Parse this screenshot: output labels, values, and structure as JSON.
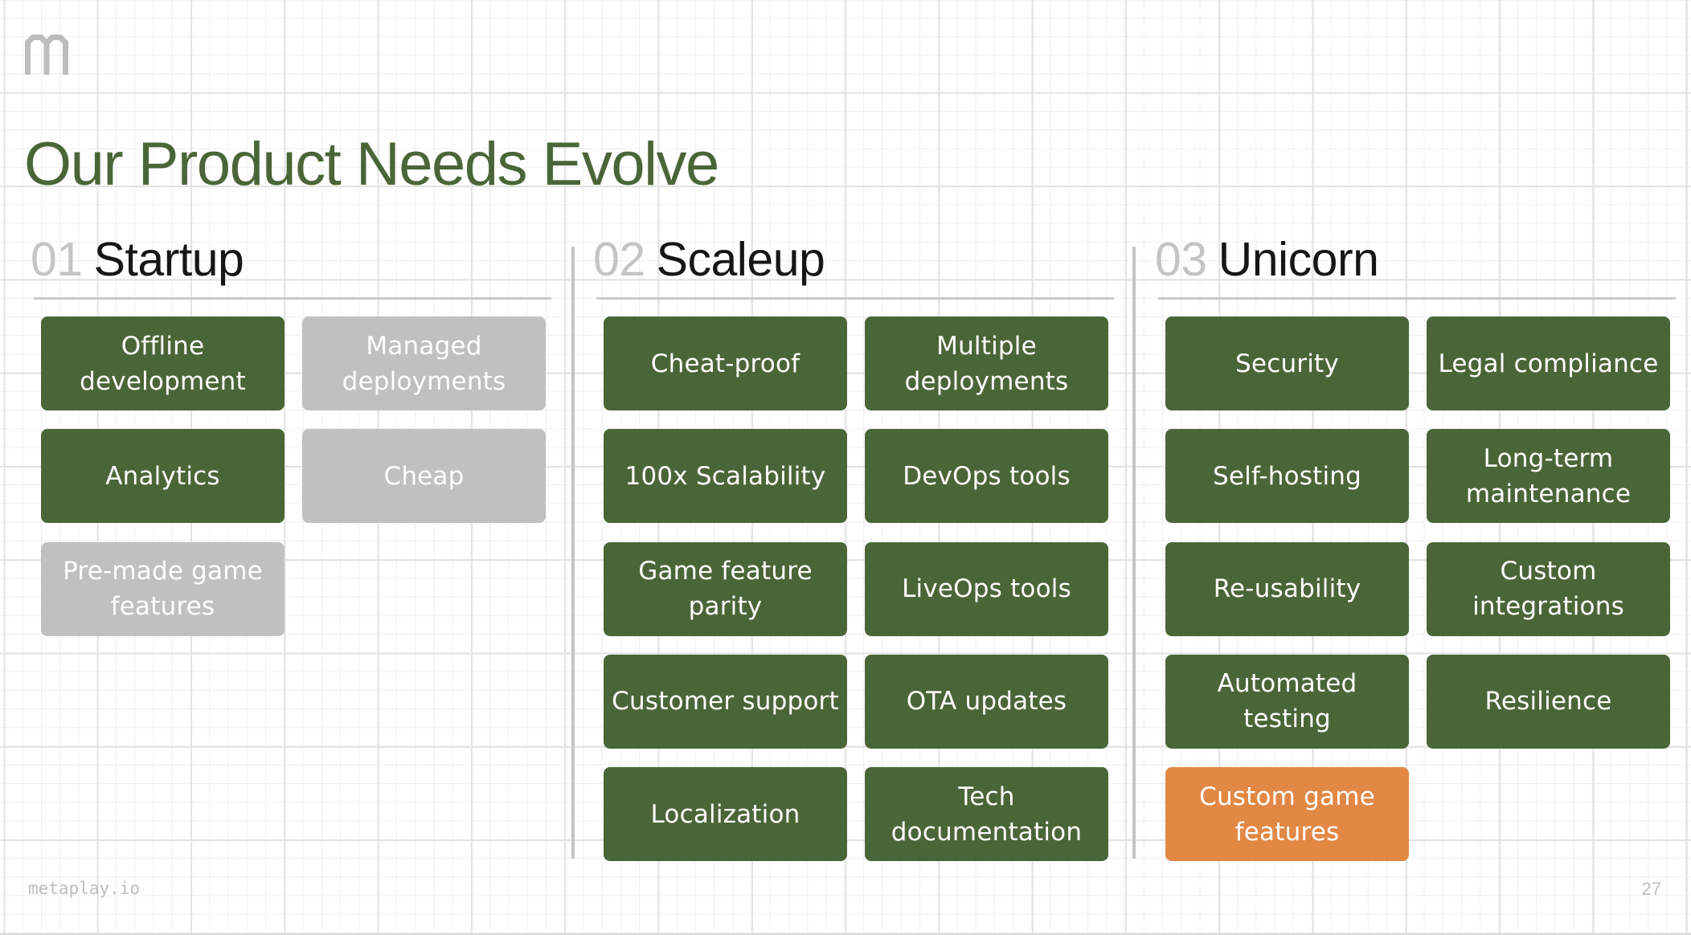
{
  "slide": {
    "logo_icon": "metaplay-m-logo",
    "title": "Our Product Needs Evolve",
    "footer_site": "metaplay.io",
    "page_number": "27",
    "colors": {
      "accent_green": "#4a6638",
      "disabled_gray": "#c0c0c0",
      "highlight_orange": "#e28845",
      "heading_number_gray": "#c4c4c4"
    }
  },
  "sections": [
    {
      "number": "01",
      "name": "Startup",
      "items": [
        {
          "label": "Offline development",
          "state": "active"
        },
        {
          "label": "Managed deployments",
          "state": "inactive"
        },
        {
          "label": "Analytics",
          "state": "active"
        },
        {
          "label": "Cheap",
          "state": "inactive"
        },
        {
          "label": "Pre-made game features",
          "state": "inactive"
        }
      ]
    },
    {
      "number": "02",
      "name": "Scaleup",
      "items": [
        {
          "label": "Cheat-proof",
          "state": "active"
        },
        {
          "label": "Multiple deployments",
          "state": "active"
        },
        {
          "label": "100x Scalability",
          "state": "active"
        },
        {
          "label": "DevOps tools",
          "state": "active"
        },
        {
          "label": "Game feature parity",
          "state": "active"
        },
        {
          "label": "LiveOps tools",
          "state": "active"
        },
        {
          "label": "Customer support",
          "state": "active"
        },
        {
          "label": "OTA updates",
          "state": "active"
        },
        {
          "label": "Localization",
          "state": "active"
        },
        {
          "label": "Tech documentation",
          "state": "active"
        }
      ]
    },
    {
      "number": "03",
      "name": "Unicorn",
      "items": [
        {
          "label": "Security",
          "state": "active"
        },
        {
          "label": "Legal compliance",
          "state": "active"
        },
        {
          "label": "Self-hosting",
          "state": "active"
        },
        {
          "label": "Long-term maintenance",
          "state": "active"
        },
        {
          "label": "Re-usability",
          "state": "active"
        },
        {
          "label": "Custom integrations",
          "state": "active"
        },
        {
          "label": "Automated testing",
          "state": "active"
        },
        {
          "label": "Resilience",
          "state": "active"
        },
        {
          "label": "Custom game features",
          "state": "highlight"
        }
      ]
    }
  ]
}
